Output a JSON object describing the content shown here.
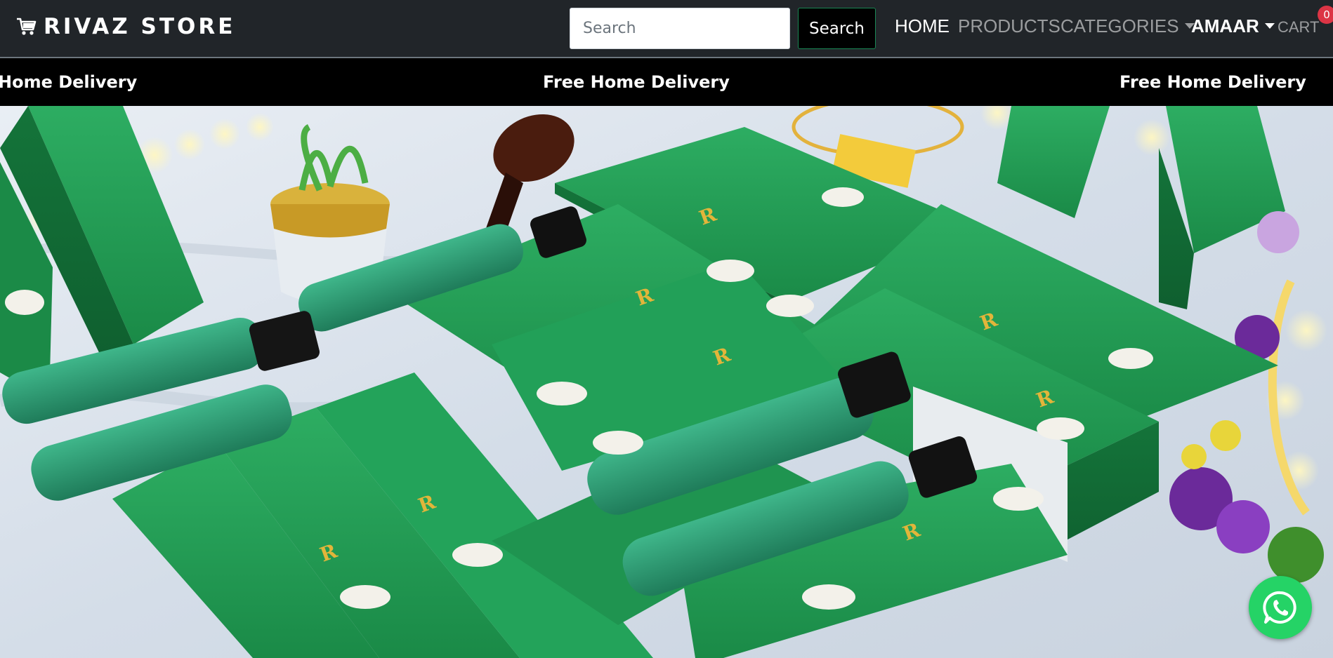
{
  "brand": {
    "name": "RIVAZ STORE",
    "icon": "shopping-cart-icon"
  },
  "search": {
    "placeholder": "Search",
    "value": "",
    "button_label": "Search"
  },
  "nav": {
    "home": "HOME",
    "products": "PRODUCTS",
    "categories": "CATEGORIES",
    "user": "AMAAR",
    "cart": "CART",
    "cart_count": "0"
  },
  "strip": {
    "messages": [
      "Home Delivery",
      "Free Home Delivery",
      "Free Home Delivery"
    ]
  },
  "hero": {
    "image": "green hair oil product boxes and bottles display"
  },
  "whatsapp": {
    "icon": "whatsapp-icon"
  },
  "colors": {
    "navbar_bg": "#212529",
    "strip_bg": "#000000",
    "whatsapp_green": "#25d366",
    "badge_red": "#dc3545",
    "product_green": "#1f9a4e"
  }
}
